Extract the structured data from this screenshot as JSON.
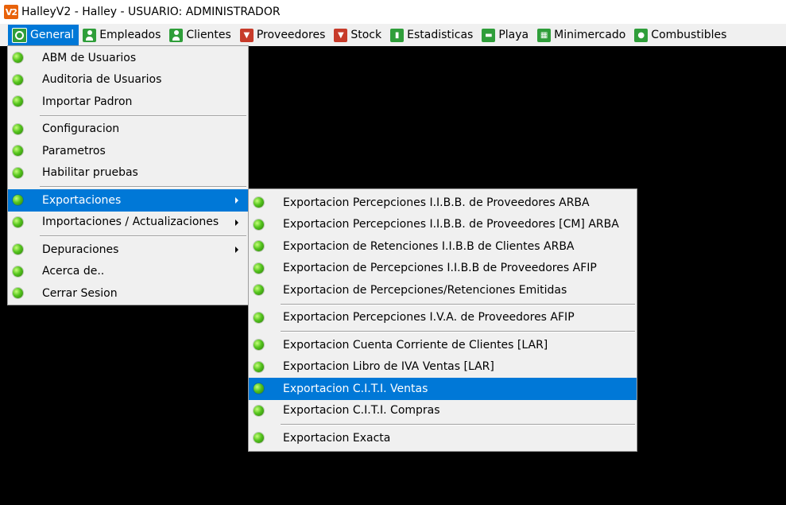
{
  "window": {
    "app_icon_text": "V2",
    "title": "HalleyV2 - Halley - USUARIO: ADMINISTRADOR"
  },
  "menubar": {
    "items": [
      {
        "label": "General",
        "icon": "gear-icon"
      },
      {
        "label": "Empleados",
        "icon": "person-icon"
      },
      {
        "label": "Clientes",
        "icon": "person-icon"
      },
      {
        "label": "Proveedores",
        "icon": "cart-icon"
      },
      {
        "label": "Stock",
        "icon": "cart-icon"
      },
      {
        "label": "Estadisticas",
        "icon": "chart-icon"
      },
      {
        "label": "Playa",
        "icon": "car-icon"
      },
      {
        "label": "Minimercado",
        "icon": "shop-icon"
      },
      {
        "label": "Combustibles",
        "icon": "fuel-icon"
      }
    ]
  },
  "general_menu": {
    "items": [
      {
        "label": "ABM de Usuarios"
      },
      {
        "label": "Auditoria de Usuarios"
      },
      {
        "label": "Importar Padron"
      },
      {
        "label": "Configuracion"
      },
      {
        "label": "Parametros"
      },
      {
        "label": "Habilitar pruebas"
      },
      {
        "label": "Exportaciones"
      },
      {
        "label": "Importaciones / Actualizaciones"
      },
      {
        "label": "Depuraciones"
      },
      {
        "label": "Acerca de.."
      },
      {
        "label": "Cerrar Sesion"
      }
    ]
  },
  "export_menu": {
    "items": [
      {
        "label": "Exportacion Percepciones I.I.B.B. de Proveedores ARBA"
      },
      {
        "label": "Exportacion Percepciones I.I.B.B. de Proveedores [CM] ARBA"
      },
      {
        "label": "Exportacion de Retenciones I.I.B.B de Clientes ARBA"
      },
      {
        "label": "Exportacion de Percepciones I.I.B.B de Proveedores AFIP"
      },
      {
        "label": "Exportacion de Percepciones/Retenciones Emitidas"
      },
      {
        "label": "Exportacion Percepciones I.V.A. de Proveedores AFIP"
      },
      {
        "label": "Exportacion Cuenta Corriente de Clientes [LAR]"
      },
      {
        "label": "Exportacion Libro de IVA Ventas [LAR]"
      },
      {
        "label": "Exportacion C.I.T.I. Ventas"
      },
      {
        "label": "Exportacion C.I.T.I. Compras"
      },
      {
        "label": "Exportacion Exacta"
      }
    ]
  },
  "colors": {
    "highlight": "#0078d7",
    "menu_bg": "#f0f0f0",
    "desktop": "#000000"
  }
}
